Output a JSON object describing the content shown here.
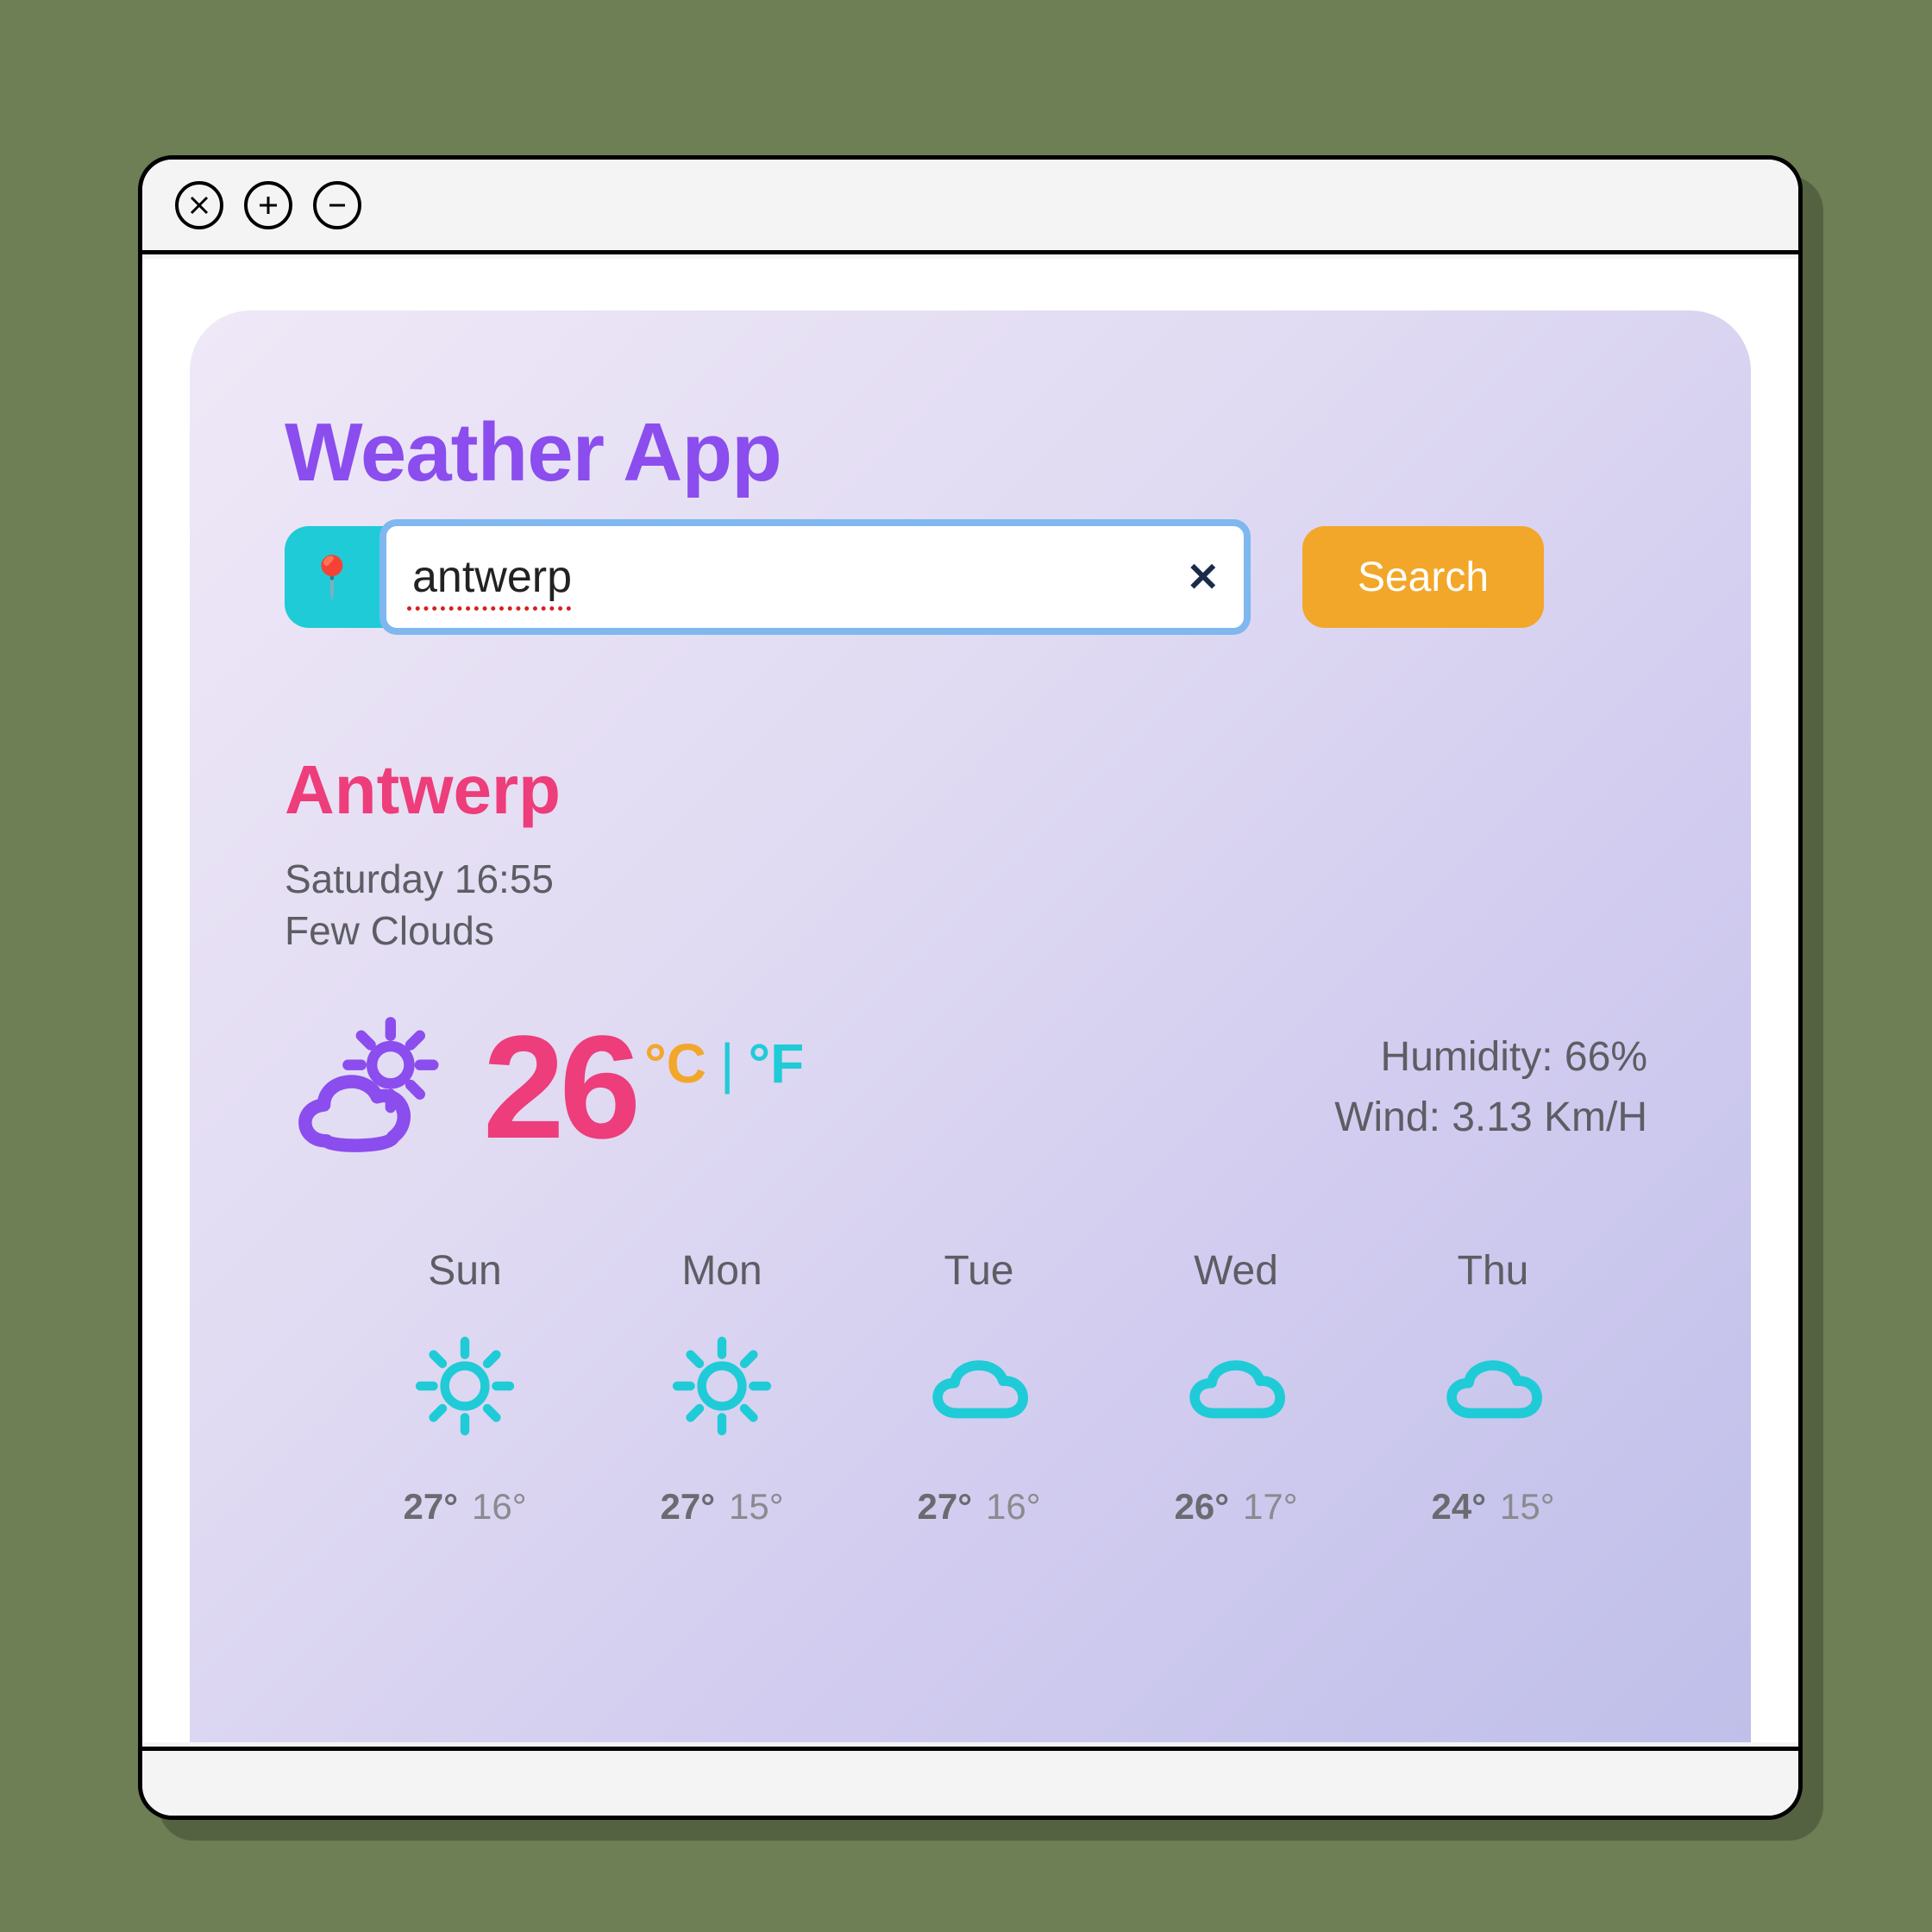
{
  "app": {
    "title": "Weather App"
  },
  "search": {
    "pin_glyph": "📍",
    "input_value": "antwerp",
    "clear_glyph": "✕",
    "button_label": "Search"
  },
  "location": {
    "city": "Antwerp",
    "datetime": "Saturday 16:55",
    "condition": "Few Clouds"
  },
  "current": {
    "temp": "26",
    "unit_c": "°C",
    "unit_sep": "|",
    "unit_f": "°F",
    "humidity_label": "Humidity: 66%",
    "wind_label": "Wind: 3.13 Km/H"
  },
  "forecast": [
    {
      "day": "Sun",
      "icon": "sun",
      "hi": "27°",
      "lo": "16°"
    },
    {
      "day": "Mon",
      "icon": "sun",
      "hi": "27°",
      "lo": "15°"
    },
    {
      "day": "Tue",
      "icon": "cloud",
      "hi": "27°",
      "lo": "16°"
    },
    {
      "day": "Wed",
      "icon": "cloud",
      "hi": "26°",
      "lo": "17°"
    },
    {
      "day": "Thu",
      "icon": "cloud",
      "hi": "24°",
      "lo": "15°"
    }
  ]
}
